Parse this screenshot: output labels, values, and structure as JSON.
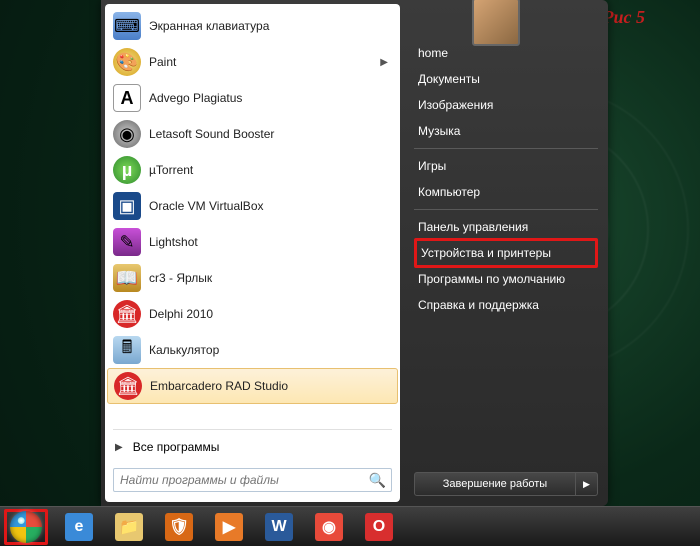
{
  "pic_label": "Рис 5",
  "programs": [
    {
      "label": "Экранная клавиатура",
      "icon": "keyboard-icon",
      "iconClass": "ic-keyboard",
      "glyph": "⌨",
      "submenu": false
    },
    {
      "label": "Paint",
      "icon": "paint-icon",
      "iconClass": "ic-paint",
      "glyph": "🎨",
      "submenu": true
    },
    {
      "label": "Advego Plagiatus",
      "icon": "advego-icon",
      "iconClass": "ic-advego",
      "glyph": "A",
      "submenu": false
    },
    {
      "label": "Letasoft Sound Booster",
      "icon": "letasoft-icon",
      "iconClass": "ic-letasoft",
      "glyph": "◉",
      "submenu": false
    },
    {
      "label": "µTorrent",
      "icon": "utorrent-icon",
      "iconClass": "ic-utorrent",
      "glyph": "µ",
      "submenu": false
    },
    {
      "label": "Oracle VM VirtualBox",
      "icon": "virtualbox-icon",
      "iconClass": "ic-virtualbox",
      "glyph": "▣",
      "submenu": false
    },
    {
      "label": "Lightshot",
      "icon": "lightshot-icon",
      "iconClass": "ic-lightshot",
      "glyph": "✎",
      "submenu": false
    },
    {
      "label": "cr3 - Ярлык",
      "icon": "cr3-icon",
      "iconClass": "ic-cr3",
      "glyph": "📖",
      "submenu": false
    },
    {
      "label": "Delphi 2010",
      "icon": "delphi-icon",
      "iconClass": "ic-delphi",
      "glyph": "🏛",
      "submenu": false
    },
    {
      "label": "Калькулятор",
      "icon": "calculator-icon",
      "iconClass": "ic-calc",
      "glyph": "🖩",
      "submenu": false
    },
    {
      "label": "Embarcadero RAD Studio",
      "icon": "rad-studio-icon",
      "iconClass": "ic-rad",
      "glyph": "🏛",
      "submenu": false,
      "selected": true
    }
  ],
  "all_programs_label": "Все программы",
  "search_placeholder": "Найти программы и файлы",
  "right_panel": {
    "groups": [
      [
        {
          "label": "home"
        },
        {
          "label": "Документы"
        },
        {
          "label": "Изображения"
        },
        {
          "label": "Музыка"
        }
      ],
      [
        {
          "label": "Игры"
        },
        {
          "label": "Компьютер"
        }
      ],
      [
        {
          "label": "Панель управления"
        },
        {
          "label": "Устройства и принтеры",
          "highlighted": true
        },
        {
          "label": "Программы по умолчанию"
        },
        {
          "label": "Справка и поддержка"
        }
      ]
    ]
  },
  "shutdown_label": "Завершение работы",
  "taskbar_icons": [
    {
      "name": "ie-icon",
      "glyph": "e",
      "bg": "#3a8ad8",
      "fg": "#fff"
    },
    {
      "name": "explorer-icon",
      "glyph": "📁",
      "bg": "#e8c870",
      "fg": "#000"
    },
    {
      "name": "firewall-icon",
      "glyph": "🛡",
      "bg": "#d86815",
      "fg": "#fff"
    },
    {
      "name": "wmp-icon",
      "glyph": "▶",
      "bg": "#e87a28",
      "fg": "#fff"
    },
    {
      "name": "word-icon",
      "glyph": "W",
      "bg": "#2a5a9a",
      "fg": "#fff"
    },
    {
      "name": "chrome-icon",
      "glyph": "◉",
      "bg": "#e84a3a",
      "fg": "#fff"
    },
    {
      "name": "opera-icon",
      "glyph": "O",
      "bg": "#d82e2e",
      "fg": "#fff"
    }
  ]
}
